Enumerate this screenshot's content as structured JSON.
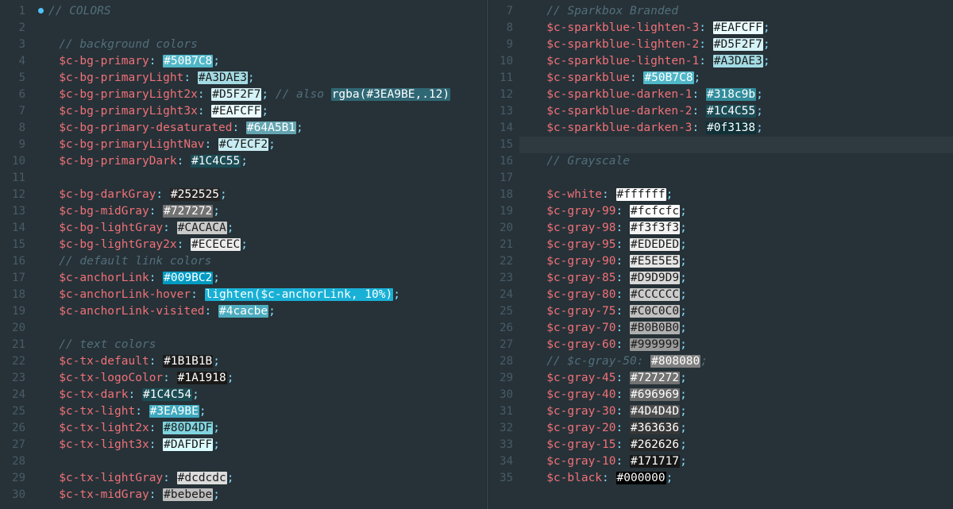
{
  "left": {
    "start": 1,
    "lines": [
      {
        "kind": "comment-dot",
        "text": "// COLORS"
      },
      {
        "kind": "blank"
      },
      {
        "kind": "comment",
        "text": "// background colors"
      },
      {
        "kind": "decl",
        "name": "$c-bg-primary",
        "swatch": "#50B7C8",
        "display": "#50B7C8",
        "fg": "light"
      },
      {
        "kind": "decl",
        "name": "$c-bg-primaryLight",
        "swatch": "#A3DAE3",
        "display": "#A3DAE3",
        "fg": "dark"
      },
      {
        "kind": "decl",
        "name": "$c-bg-primaryLight2x",
        "swatch": "#D5F2F7",
        "display": "#D5F2F7",
        "fg": "dark",
        "tail_comment": "// also ",
        "tail_swatch_bg": "rgba(62,169,190,0.45)",
        "tail_swatch_text": "rgba(#3EA9BE,.12)",
        "tail_fg": "light"
      },
      {
        "kind": "decl",
        "name": "$c-bg-primaryLight3x",
        "swatch": "#EAFCFF",
        "display": "#EAFCFF",
        "fg": "dark"
      },
      {
        "kind": "decl",
        "name": "$c-bg-primary-desaturated",
        "swatch": "#64A5B1",
        "display": "#64A5B1",
        "fg": "light"
      },
      {
        "kind": "decl",
        "name": "$c-bg-primaryLightNav",
        "swatch": "#C7ECF2",
        "display": "#C7ECF2",
        "fg": "dark"
      },
      {
        "kind": "decl",
        "name": "$c-bg-primaryDark",
        "swatch": "#1C4C55",
        "display": "#1C4C55",
        "fg": "light"
      },
      {
        "kind": "blank"
      },
      {
        "kind": "decl",
        "name": "$c-bg-darkGray",
        "swatch": "#252525",
        "display": "#252525",
        "fg": "light"
      },
      {
        "kind": "decl",
        "name": "$c-bg-midGray",
        "swatch": "#727272",
        "display": "#727272",
        "fg": "light"
      },
      {
        "kind": "decl",
        "name": "$c-bg-lightGray",
        "swatch": "#CACACA",
        "display": "#CACACA",
        "fg": "dark"
      },
      {
        "kind": "decl",
        "name": "$c-bg-lightGray2x",
        "swatch": "#ECECEC",
        "display": "#ECECEC",
        "fg": "dark"
      },
      {
        "kind": "comment",
        "text": "// default link colors"
      },
      {
        "kind": "decl",
        "name": "$c-anchorLink",
        "swatch": "#009BC2",
        "display": "#009BC2",
        "fg": "light"
      },
      {
        "kind": "decl",
        "name": "$c-anchorLink-hover",
        "swatch": "#19b0d6",
        "display": "lighten($c-anchorLink, 10%)",
        "fg": "light"
      },
      {
        "kind": "decl",
        "name": "$c-anchorLink-visited",
        "swatch": "#4cacbe",
        "display": "#4cacbe",
        "fg": "light"
      },
      {
        "kind": "blank"
      },
      {
        "kind": "comment",
        "text": "// text colors"
      },
      {
        "kind": "decl",
        "name": "$c-tx-default",
        "swatch": "#1B1B1B",
        "display": "#1B1B1B",
        "fg": "light"
      },
      {
        "kind": "decl",
        "name": "$c-tx-logoColor",
        "swatch": "#1A1918",
        "display": "#1A1918",
        "fg": "light"
      },
      {
        "kind": "decl",
        "name": "$c-tx-dark",
        "swatch": "#1C4C54",
        "display": "#1C4C54",
        "fg": "light"
      },
      {
        "kind": "decl",
        "name": "$c-tx-light",
        "swatch": "#3EA9BE",
        "display": "#3EA9BE",
        "fg": "light"
      },
      {
        "kind": "decl",
        "name": "$c-tx-light2x",
        "swatch": "#80D4DF",
        "display": "#80D4DF",
        "fg": "dark"
      },
      {
        "kind": "decl",
        "name": "$c-tx-light3x",
        "swatch": "#DAFDFF",
        "display": "#DAFDFF",
        "fg": "dark"
      },
      {
        "kind": "blank"
      },
      {
        "kind": "decl",
        "name": "$c-tx-lightGray",
        "swatch": "#dcdcdc",
        "display": "#dcdcdc",
        "fg": "dark"
      },
      {
        "kind": "decl",
        "name": "$c-tx-midGray",
        "swatch": "#bebebe",
        "display": "#bebebe",
        "fg": "dark"
      }
    ]
  },
  "right": {
    "start": 7,
    "cursor_index": 8,
    "lines": [
      {
        "kind": "comment",
        "text": "// Sparkbox Branded"
      },
      {
        "kind": "decl",
        "name": "$c-sparkblue-lighten-3",
        "swatch": "#EAFCFF",
        "display": "#EAFCFF",
        "fg": "dark"
      },
      {
        "kind": "decl",
        "name": "$c-sparkblue-lighten-2",
        "swatch": "#D5F2F7",
        "display": "#D5F2F7",
        "fg": "dark"
      },
      {
        "kind": "decl",
        "name": "$c-sparkblue-lighten-1",
        "swatch": "#A3DAE3",
        "display": "#A3DAE3",
        "fg": "dark"
      },
      {
        "kind": "decl",
        "name": "$c-sparkblue",
        "swatch": "#50B7C8",
        "display": "#50B7C8",
        "fg": "light"
      },
      {
        "kind": "decl",
        "name": "$c-sparkblue-darken-1",
        "swatch": "#318c9b",
        "display": "#318c9b",
        "fg": "light"
      },
      {
        "kind": "decl",
        "name": "$c-sparkblue-darken-2",
        "swatch": "#1C4C55",
        "display": "#1C4C55",
        "fg": "light"
      },
      {
        "kind": "decl",
        "name": "$c-sparkblue-darken-3",
        "swatch": "#0f3138",
        "display": "#0f3138",
        "fg": "light"
      },
      {
        "kind": "blank"
      },
      {
        "kind": "comment",
        "text": "// Grayscale"
      },
      {
        "kind": "blank"
      },
      {
        "kind": "decl",
        "name": "$c-white",
        "swatch": "#ffffff",
        "display": "#ffffff",
        "fg": "dark"
      },
      {
        "kind": "decl",
        "name": "$c-gray-99",
        "swatch": "#fcfcfc",
        "display": "#fcfcfc",
        "fg": "dark"
      },
      {
        "kind": "decl",
        "name": "$c-gray-98",
        "swatch": "#f3f3f3",
        "display": "#f3f3f3",
        "fg": "dark"
      },
      {
        "kind": "decl",
        "name": "$c-gray-95",
        "swatch": "#EDEDED",
        "display": "#EDEDED",
        "fg": "dark"
      },
      {
        "kind": "decl",
        "name": "$c-gray-90",
        "swatch": "#E5E5E5",
        "display": "#E5E5E5",
        "fg": "dark"
      },
      {
        "kind": "decl",
        "name": "$c-gray-85",
        "swatch": "#D9D9D9",
        "display": "#D9D9D9",
        "fg": "dark"
      },
      {
        "kind": "decl",
        "name": "$c-gray-80",
        "swatch": "#CCCCCC",
        "display": "#CCCCCC",
        "fg": "dark"
      },
      {
        "kind": "decl",
        "name": "$c-gray-75",
        "swatch": "#C0C0C0",
        "display": "#C0C0C0",
        "fg": "dark"
      },
      {
        "kind": "decl",
        "name": "$c-gray-70",
        "swatch": "#B0B0B0",
        "display": "#B0B0B0",
        "fg": "dark"
      },
      {
        "kind": "decl",
        "name": "$c-gray-60",
        "swatch": "#999999",
        "display": "#999999",
        "fg": "dark"
      },
      {
        "kind": "commented-decl",
        "prefix": "// $c-gray-50: ",
        "swatch": "#808080",
        "display": "#808080",
        "fg": "light"
      },
      {
        "kind": "decl",
        "name": "$c-gray-45",
        "swatch": "#727272",
        "display": "#727272",
        "fg": "light"
      },
      {
        "kind": "decl",
        "name": "$c-gray-40",
        "swatch": "#696969",
        "display": "#696969",
        "fg": "light"
      },
      {
        "kind": "decl",
        "name": "$c-gray-30",
        "swatch": "#4D4D4D",
        "display": "#4D4D4D",
        "fg": "light"
      },
      {
        "kind": "decl",
        "name": "$c-gray-20",
        "swatch": "#363636",
        "display": "#363636",
        "fg": "light"
      },
      {
        "kind": "decl",
        "name": "$c-gray-15",
        "swatch": "#262626",
        "display": "#262626",
        "fg": "light"
      },
      {
        "kind": "decl",
        "name": "$c-gray-10",
        "swatch": "#171717",
        "display": "#171717",
        "fg": "light"
      },
      {
        "kind": "decl",
        "name": "$c-black",
        "swatch": "#000000",
        "display": "#000000",
        "fg": "light"
      }
    ]
  }
}
